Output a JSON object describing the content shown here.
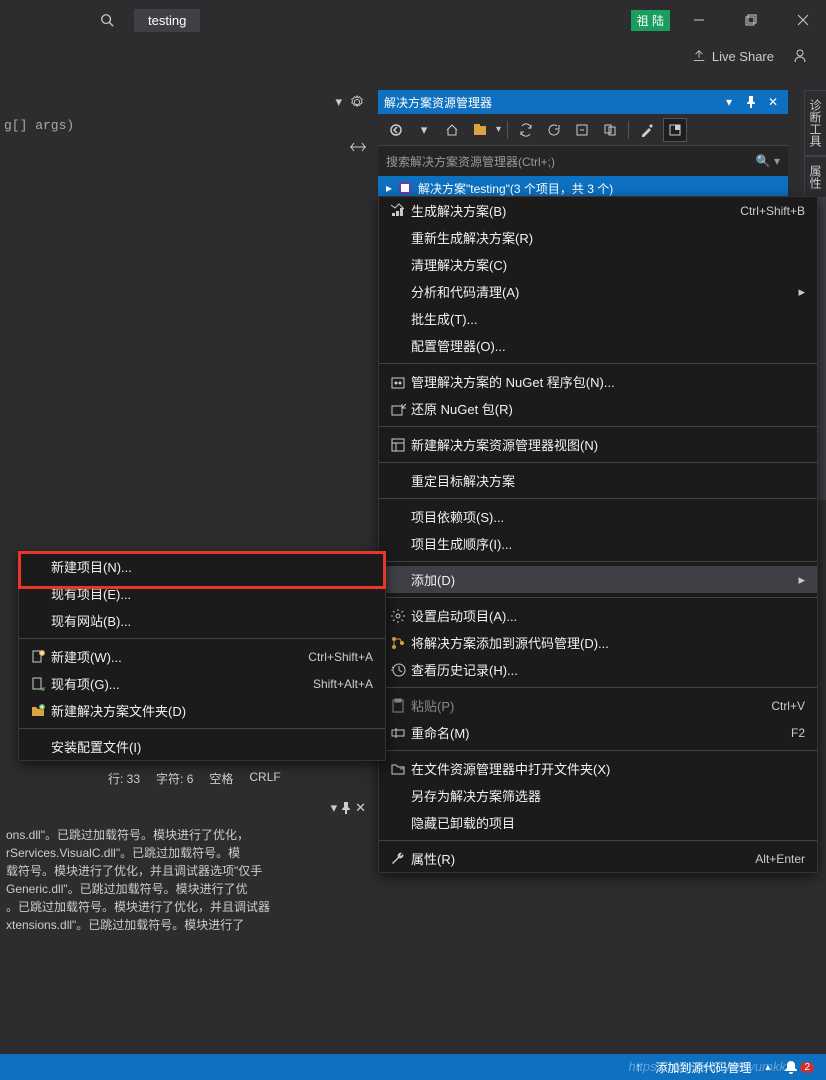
{
  "titlebar": {
    "project_name": "testing",
    "user_badge": "祖 陆"
  },
  "topbar": {
    "live_share": "Live Share"
  },
  "editor": {
    "visible_code": "g[] args)"
  },
  "solution_explorer": {
    "title": "解决方案资源管理器",
    "search_placeholder": "搜索解决方案资源管理器(Ctrl+;)",
    "root": "解决方案\"testing\"(3 个项目，共 3 个)"
  },
  "side_tabs": {
    "diagnostic": "诊断工具",
    "properties": "属性"
  },
  "context_menu": {
    "items": [
      {
        "icon": "build",
        "label": "生成解决方案(B)",
        "shortcut": "Ctrl+Shift+B"
      },
      {
        "label": "重新生成解决方案(R)"
      },
      {
        "label": "清理解决方案(C)"
      },
      {
        "label": "分析和代码清理(A)",
        "arrow": true
      },
      {
        "label": "批生成(T)..."
      },
      {
        "label": "配置管理器(O)..."
      },
      {
        "sep": true
      },
      {
        "icon": "nuget",
        "label": "管理解决方案的 NuGet 程序包(N)..."
      },
      {
        "icon": "restore",
        "label": "还原 NuGet 包(R)"
      },
      {
        "sep": true
      },
      {
        "icon": "view",
        "label": "新建解决方案资源管理器视图(N)"
      },
      {
        "sep": true
      },
      {
        "label": "重定目标解决方案"
      },
      {
        "sep": true
      },
      {
        "label": "项目依赖项(S)..."
      },
      {
        "label": "项目生成顺序(I)..."
      },
      {
        "sep": true
      },
      {
        "label": "添加(D)",
        "arrow": true,
        "hover": true
      },
      {
        "sep": true
      },
      {
        "icon": "gear",
        "label": "设置启动项目(A)..."
      },
      {
        "icon": "git",
        "label": "将解决方案添加到源代码管理(D)..."
      },
      {
        "icon": "history",
        "label": "查看历史记录(H)..."
      },
      {
        "sep": true
      },
      {
        "icon": "paste",
        "label": "粘贴(P)",
        "shortcut": "Ctrl+V",
        "disabled": true
      },
      {
        "icon": "rename",
        "label": "重命名(M)",
        "shortcut": "F2"
      },
      {
        "sep": true
      },
      {
        "icon": "folder",
        "label": "在文件资源管理器中打开文件夹(X)"
      },
      {
        "label": "另存为解决方案筛选器"
      },
      {
        "label": "隐藏已卸载的项目"
      },
      {
        "sep": true
      },
      {
        "icon": "wrench",
        "label": "属性(R)",
        "shortcut": "Alt+Enter"
      }
    ]
  },
  "submenu": {
    "items": [
      {
        "label": "新建项目(N)..."
      },
      {
        "label": "现有项目(E)..."
      },
      {
        "label": "现有网站(B)..."
      },
      {
        "sep": true
      },
      {
        "icon": "newitem",
        "label": "新建项(W)...",
        "shortcut": "Ctrl+Shift+A"
      },
      {
        "icon": "existitem",
        "label": "现有项(G)...",
        "shortcut": "Shift+Alt+A"
      },
      {
        "icon": "newfolder",
        "label": "新建解决方案文件夹(D)"
      },
      {
        "sep": true
      },
      {
        "label": "安装配置文件(I)"
      }
    ]
  },
  "status_info": {
    "line": "行: 33",
    "char": "字符: 6",
    "spaces": "空格",
    "crlf": "CRLF"
  },
  "output": {
    "lines": [
      "ons.dll\"。已跳过加载符号。模块进行了优化，",
      "rServices.VisualC.dll\"。已跳过加载符号。模",
      "载符号。模块进行了优化，并且调试器选项\"仅手",
      "Generic.dll\"。已跳过加载符号。模块进行了优",
      "。已跳过加载符号。模块进行了优化，并且调试器",
      "xtensions.dll\"。已跳过加载符号。模块进行了"
    ]
  },
  "bottom_status": {
    "add_source_control": "添加到源代码管理",
    "notifications": "2"
  },
  "watermark": "https://blog.csdn.net/yumkk"
}
